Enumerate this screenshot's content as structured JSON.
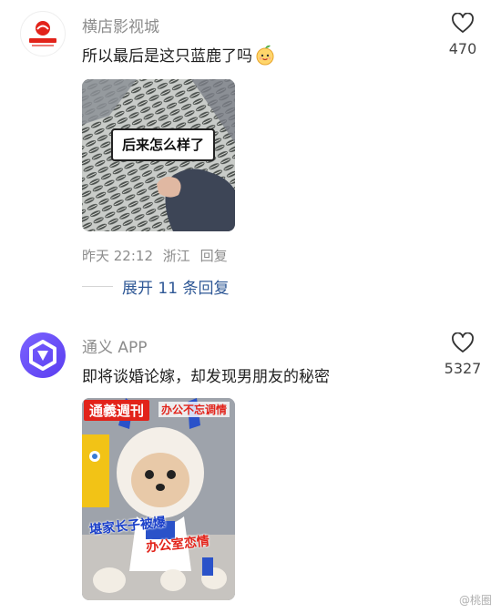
{
  "comments": [
    {
      "username": "横店影视城",
      "avatar_icon": "hengdian-logo",
      "text": "所以最后是这只蓝鹿了吗",
      "emoji_icon": "smiling-peach-emoji",
      "likes": "470",
      "image_caption": "后来怎么样了",
      "time": "昨天 22:12",
      "location": "浙江",
      "reply_label": "回复",
      "expand_label": "展开 11 条回复"
    },
    {
      "username": "通义 APP",
      "avatar_icon": "tongyi-logo",
      "text": "即将谈婚论嫁，却发现男朋友的秘密",
      "likes": "5327",
      "image_title": "通義週刊",
      "image_subtitle": "办公不忘调情",
      "image_caption_1": "堪家长子被爆",
      "image_caption_2": "办公室恋情"
    }
  ],
  "watermark": "@桃圈",
  "colors": {
    "link": "#2f5896",
    "muted": "#8c8c8c",
    "accent_red": "#e2231a",
    "avatar_purple": "#6a4cff"
  }
}
